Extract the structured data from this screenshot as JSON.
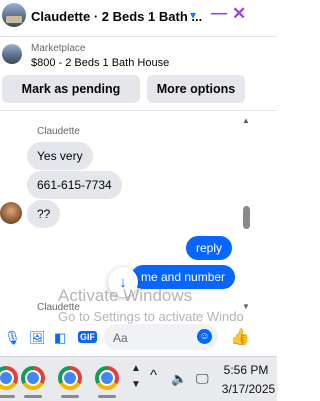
{
  "header": {
    "title": "Claudette · 2 Beds 1 Bath ...",
    "chevron_icon": "▾",
    "minimize_icon": "—",
    "close_icon": "✕"
  },
  "listing": {
    "label": "Marketplace",
    "title": "$800 - 2 Beds 1 Bath House"
  },
  "actions": {
    "pending_label": "Mark as pending",
    "more_label": "More options"
  },
  "chat": {
    "sender_top": "Claudette",
    "messages_in": [
      "Yes very",
      "661-615-7734",
      "??"
    ],
    "messages_out": [
      "reply",
      "me and number"
    ],
    "sender_bottom": "Claudette"
  },
  "composer": {
    "placeholder": "Aa",
    "icons": [
      "mic-icon",
      "photo-icon",
      "sticker-icon",
      "gif-icon"
    ],
    "gif_label": "GIF",
    "like_icon": "👍"
  },
  "watermark": {
    "line1": "Activate Windows",
    "line2": "Go to Settings to activate Windo"
  },
  "taskbar": {
    "time": "5:56 PM",
    "date": "3/17/2025",
    "chevron_up": "^"
  },
  "colors": {
    "accent": "#0866ff",
    "header_controls": "#a040e0"
  }
}
